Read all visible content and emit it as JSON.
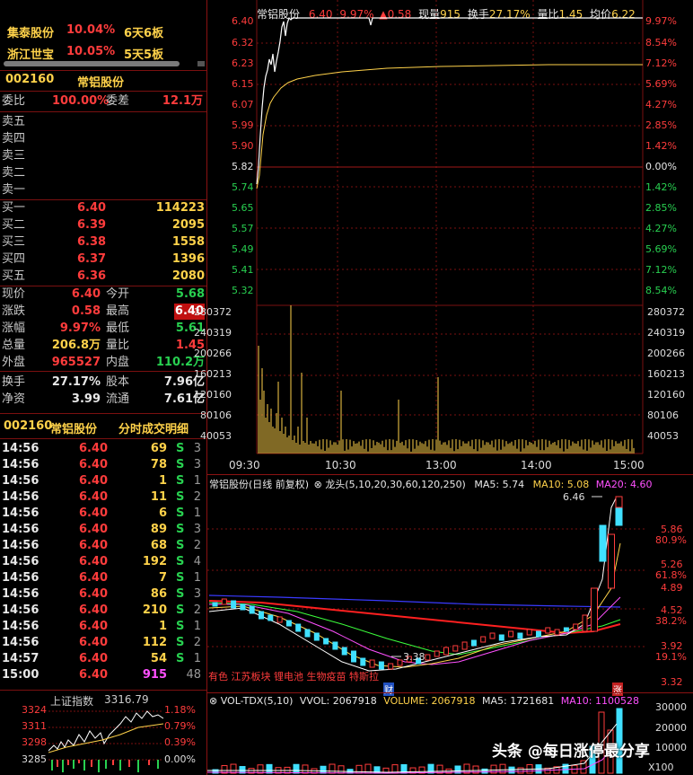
{
  "hot": [
    {
      "name": "集泰股份",
      "pct": "10.04%",
      "streak": "6天6板"
    },
    {
      "name": "浙江世宝",
      "pct": "10.05%",
      "streak": "5天5板"
    }
  ],
  "stock": {
    "code": "002160",
    "name": "常铝股份"
  },
  "weibi": {
    "label": "委比",
    "value": "100.00%",
    "diff_label": "委差",
    "diff": "12.1万"
  },
  "sells": [
    "卖五",
    "卖四",
    "卖三",
    "卖二",
    "卖一"
  ],
  "buys": [
    {
      "label": "买一",
      "price": "6.40",
      "vol": "114223"
    },
    {
      "label": "买二",
      "price": "6.39",
      "vol": "2095"
    },
    {
      "label": "买三",
      "price": "6.38",
      "vol": "1558"
    },
    {
      "label": "买四",
      "price": "6.37",
      "vol": "1396"
    },
    {
      "label": "买五",
      "price": "6.36",
      "vol": "2080"
    }
  ],
  "quote": [
    {
      "l1": "现价",
      "v1": "6.40",
      "l2": "今开",
      "v2": "5.68"
    },
    {
      "l1": "涨跌",
      "v1": "0.58",
      "l2": "最高",
      "v2": "6.40"
    },
    {
      "l1": "涨幅",
      "v1": "9.97%",
      "l2": "最低",
      "v2": "5.61"
    },
    {
      "l1": "总量",
      "v1": "206.8万",
      "l2": "量比",
      "v2": "1.45"
    },
    {
      "l1": "外盘",
      "v1": "965527",
      "l2": "内盘",
      "v2": "110.2万"
    },
    {
      "l1": "换手",
      "v1": "27.17%",
      "l2": "股本",
      "v2": "7.96亿"
    },
    {
      "l1": "净资",
      "v1": "3.99",
      "l2": "流通",
      "v2": "7.61亿"
    }
  ],
  "ticks_header": {
    "code": "002160",
    "name": "常铝股份",
    "title": "分时成交明细"
  },
  "ticks": [
    {
      "t": "14:56",
      "p": "6.40",
      "v": "69",
      "d": "S",
      "n": "3"
    },
    {
      "t": "14:56",
      "p": "6.40",
      "v": "78",
      "d": "S",
      "n": "3"
    },
    {
      "t": "14:56",
      "p": "6.40",
      "v": "1",
      "d": "S",
      "n": "1"
    },
    {
      "t": "14:56",
      "p": "6.40",
      "v": "11",
      "d": "S",
      "n": "2"
    },
    {
      "t": "14:56",
      "p": "6.40",
      "v": "6",
      "d": "S",
      "n": "1"
    },
    {
      "t": "14:56",
      "p": "6.40",
      "v": "89",
      "d": "S",
      "n": "3"
    },
    {
      "t": "14:56",
      "p": "6.40",
      "v": "68",
      "d": "S",
      "n": "2"
    },
    {
      "t": "14:56",
      "p": "6.40",
      "v": "192",
      "d": "S",
      "n": "4"
    },
    {
      "t": "14:56",
      "p": "6.40",
      "v": "7",
      "d": "S",
      "n": "1"
    },
    {
      "t": "14:56",
      "p": "6.40",
      "v": "86",
      "d": "S",
      "n": "3"
    },
    {
      "t": "14:56",
      "p": "6.40",
      "v": "210",
      "d": "S",
      "n": "2"
    },
    {
      "t": "14:56",
      "p": "6.40",
      "v": "1",
      "d": "S",
      "n": "1"
    },
    {
      "t": "14:56",
      "p": "6.40",
      "v": "112",
      "d": "S",
      "n": "2"
    },
    {
      "t": "14:57",
      "p": "6.40",
      "v": "54",
      "d": "S",
      "n": "1"
    },
    {
      "t": "15:00",
      "p": "6.40",
      "v": "915",
      "d": "",
      "n": "48"
    }
  ],
  "index": {
    "name": "上证指数",
    "value": "3316.79",
    "left_axis": [
      "3324",
      "3311",
      "3298",
      "3285"
    ],
    "right_axis": [
      "1.18%",
      "0.79%",
      "0.39%",
      "0.00%"
    ]
  },
  "intraday": {
    "header": {
      "name": "常铝股份",
      "price": "6.40",
      "pct": "9.97%",
      "chg": "▲0.58",
      "xl_label": "现量",
      "xl": "915",
      "hs_label": "换手",
      "hs": "27.17%",
      "lb_label": "量比",
      "lb": "1.45",
      "jj_label": "均价",
      "jj": "6.22"
    },
    "price_axis": [
      "6.40",
      "6.32",
      "6.23",
      "6.15",
      "6.07",
      "5.99",
      "5.90",
      "5.82",
      "5.74",
      "5.65",
      "5.57",
      "5.49",
      "5.41",
      "5.32"
    ],
    "pct_axis": [
      "9.97%",
      "8.54%",
      "7.12%",
      "5.69%",
      "4.27%",
      "2.85%",
      "1.42%",
      "0.00%",
      "1.42%",
      "2.85%",
      "4.27%",
      "5.69%",
      "7.12%",
      "8.54%"
    ],
    "vol_axis": [
      "280372",
      "240319",
      "200266",
      "160213",
      "120160",
      "80106",
      "40053"
    ],
    "time_axis": [
      "09:30",
      "10:30",
      "13:00",
      "14:00",
      "15:00"
    ]
  },
  "daily": {
    "header": {
      "title": "常铝股份(日线 前复权)",
      "ind": "龙头(5,10,20,30,60,120,250)",
      "ma5": "MA5: 5.74",
      "ma10": "MA10: 5.08",
      "ma20": "MA20: 4.60"
    },
    "price_axis": [
      "5.86",
      "5.26",
      "4.89",
      "4.52",
      "3.92",
      "3.32"
    ],
    "fib_axis": [
      "80.9%",
      "61.8%",
      "38.2%",
      "19.1%"
    ],
    "high_label": "6.46",
    "low_label": "3.38",
    "tags": "有色 江苏板块 锂电池 生物疫苗 特斯拉",
    "cai": "财",
    "zhang": "涨"
  },
  "vol": {
    "header": "VOL-TDX(5,10)",
    "vvol": "VVOL: 2067918",
    "volume": "VOLUME: 2067918",
    "ma5": "MA5: 1721681",
    "ma10": "MA10: 1100528",
    "axis": [
      "30000",
      "20000",
      "10000"
    ],
    "unit": "X100"
  },
  "watermark": "头条 @每日涨停最分享",
  "colors": {
    "up": "#ff3c3c",
    "down": "#28d050",
    "accent": "#ffd24a",
    "bg": "#000000"
  }
}
